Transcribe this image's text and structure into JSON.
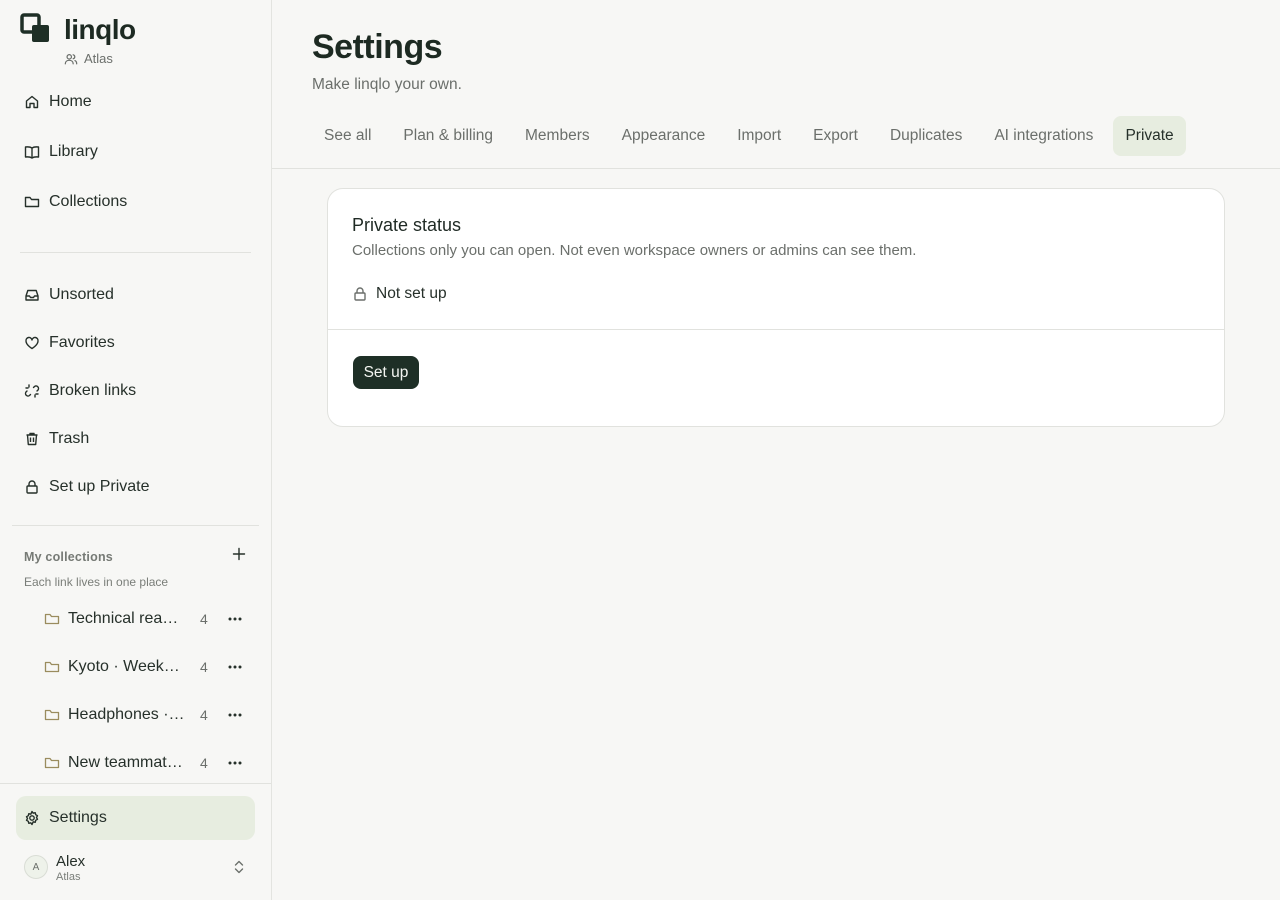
{
  "brand": {
    "name": "linqlo",
    "workspace": "Atlas"
  },
  "nav": {
    "primary": [
      {
        "label": "Home",
        "icon": "home-icon"
      },
      {
        "label": "Library",
        "icon": "book-icon"
      },
      {
        "label": "Collections",
        "icon": "folder-icon"
      }
    ],
    "secondary": [
      {
        "label": "Unsorted",
        "icon": "inbox-icon"
      },
      {
        "label": "Favorites",
        "icon": "heart-icon"
      },
      {
        "label": "Broken links",
        "icon": "broken-link-icon"
      },
      {
        "label": "Trash",
        "icon": "trash-icon"
      },
      {
        "label": "Set up Private",
        "icon": "lock-icon"
      }
    ]
  },
  "my_collections": {
    "title": "My collections",
    "subtitle": "Each link lives in one place",
    "items": [
      {
        "name": "Technical reading",
        "count": "4"
      },
      {
        "name": "Kyoto · Weekend",
        "count": "4"
      },
      {
        "name": "Headphones · research",
        "count": "4"
      },
      {
        "name": "New teammate onboarding",
        "count": "4"
      }
    ]
  },
  "footer": {
    "settings_label": "Settings",
    "user": {
      "initial": "A",
      "name": "Alex",
      "workspace": "Atlas"
    }
  },
  "header": {
    "title": "Settings",
    "subtitle": "Make linqlo your own."
  },
  "tabs": [
    {
      "label": "See all",
      "active": false
    },
    {
      "label": "Plan & billing",
      "active": false
    },
    {
      "label": "Members",
      "active": false
    },
    {
      "label": "Appearance",
      "active": false
    },
    {
      "label": "Import",
      "active": false
    },
    {
      "label": "Export",
      "active": false
    },
    {
      "label": "Duplicates",
      "active": false
    },
    {
      "label": "AI integrations",
      "active": false
    },
    {
      "label": "Private",
      "active": true
    }
  ],
  "private_card": {
    "title": "Private status",
    "description": "Collections only you can open. Not even workspace owners or admins can see them.",
    "status": "Not set up",
    "button": "Set up"
  },
  "colors": {
    "accent_bg": "#e7ede0",
    "primary_button": "#1e2f26",
    "text": "#26302a"
  }
}
